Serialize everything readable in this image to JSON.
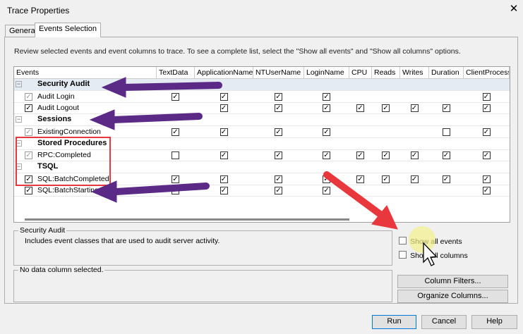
{
  "window": {
    "title": "Trace Properties",
    "close_label": "✕"
  },
  "tabs": [
    {
      "label": "General",
      "active": false
    },
    {
      "label": "Events Selection",
      "active": true
    }
  ],
  "description": "Review selected events and event columns to trace. To see a complete list, select the \"Show all events\" and \"Show all columns\" options.",
  "grid": {
    "columns": [
      "Events",
      "TextData",
      "ApplicationName",
      "NTUserName",
      "LoginName",
      "CPU",
      "Reads",
      "Writes",
      "Duration",
      "ClientProcessI"
    ],
    "rows": [
      {
        "type": "group",
        "label": "Security Audit",
        "selected": true
      },
      {
        "type": "event",
        "label": "Audit Login",
        "enabled": false,
        "cells": [
          1,
          1,
          1,
          1,
          null,
          null,
          null,
          null,
          1
        ]
      },
      {
        "type": "event",
        "label": "Audit Logout",
        "enabled": true,
        "cells": [
          null,
          1,
          1,
          1,
          1,
          1,
          1,
          1,
          1
        ]
      },
      {
        "type": "group",
        "label": "Sessions"
      },
      {
        "type": "event",
        "label": "ExistingConnection",
        "enabled": false,
        "cells": [
          1,
          1,
          1,
          1,
          null,
          null,
          null,
          0,
          1
        ]
      },
      {
        "type": "group",
        "label": "Stored Procedures"
      },
      {
        "type": "event",
        "label": "RPC:Completed",
        "enabled": false,
        "cells": [
          0,
          1,
          1,
          1,
          1,
          1,
          1,
          1,
          1
        ]
      },
      {
        "type": "group",
        "label": "TSQL"
      },
      {
        "type": "event",
        "label": "SQL:BatchCompleted",
        "enabled": true,
        "cells": [
          1,
          1,
          1,
          1,
          1,
          1,
          1,
          1,
          1
        ]
      },
      {
        "type": "event",
        "label": "SQL:BatchStarting",
        "enabled": true,
        "cells": [
          1,
          1,
          1,
          1,
          null,
          null,
          null,
          null,
          1
        ]
      }
    ]
  },
  "info_box": {
    "title": "Security Audit",
    "text": "Includes event classes that are used to audit server activity."
  },
  "column_box": {
    "title": "No data column selected."
  },
  "options": {
    "show_all_events": {
      "label": "Show all events",
      "checked": false
    },
    "show_all_columns": {
      "label": "Show all columns",
      "checked": false
    }
  },
  "buttons": {
    "column_filters": "Column Filters...",
    "organize_columns": "Organize Columns...",
    "run": "Run",
    "cancel": "Cancel",
    "help": "Help"
  },
  "colors": {
    "annotation_purple": "#5b2a86",
    "annotation_red": "#e8383d",
    "highlight": "#f3f08a"
  }
}
